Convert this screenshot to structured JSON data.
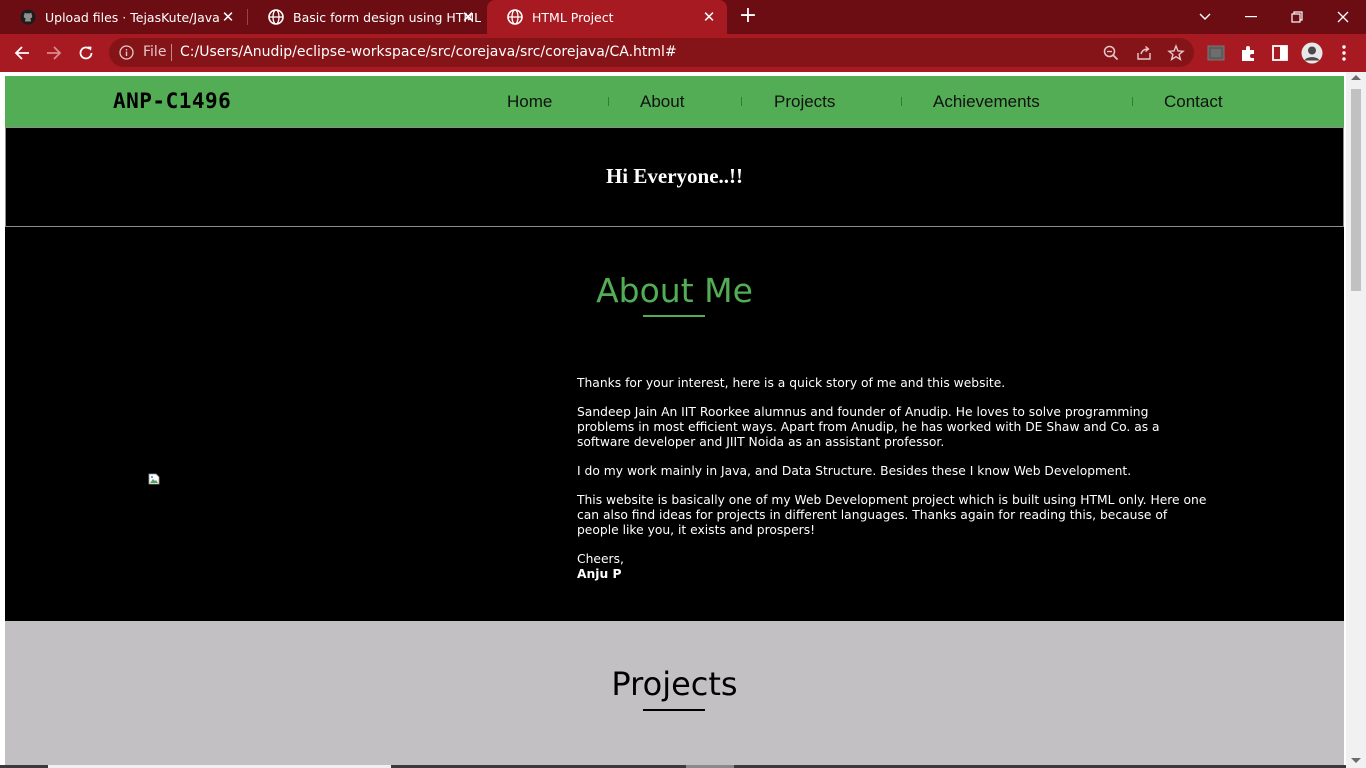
{
  "browser": {
    "tabs": [
      {
        "title": "Upload files · TejasKute/Java",
        "icon": "github-icon",
        "active": false
      },
      {
        "title": "Basic form design using HTML",
        "icon": "globe-icon",
        "active": false
      },
      {
        "title": "HTML Project",
        "icon": "globe-icon",
        "active": true
      }
    ],
    "address": {
      "scheme_label": "File",
      "url": "C:/Users/Anudip/eclipse-workspace/src/corejava/src/corejava/CA.html#"
    },
    "colors": {
      "tabstrip": "#6b0d12",
      "active_tab": "#a71a21",
      "omnibox": "#851419"
    }
  },
  "site": {
    "brand": "ANP-C1496",
    "nav": [
      "Home",
      "About",
      "Projects",
      "Achievements",
      "Contact"
    ],
    "hero_text": "Hi Everyone..!!",
    "about": {
      "title": "About Me",
      "paragraphs": [
        "Thanks for your interest, here is a quick story of me and this website.",
        "Sandeep Jain An IIT Roorkee alumnus and founder of Anudip. He loves to solve programming problems in most efficient ways. Apart from Anudip, he has worked with DE Shaw and Co. as a software developer and JIIT Noida as an assistant professor.",
        "I do my work mainly in Java, and Data Structure. Besides these I know Web Development.",
        "This website is basically one of my Web Development project which is built using HTML only. Here one can also find ideas for projects in different languages. Thanks again for reading this, because of people like you, it exists and prospers!"
      ],
      "signoff": "Cheers,",
      "signature": "Anju P"
    },
    "projects_title": "Projects",
    "colors": {
      "accent": "#52ad54",
      "dark_bg": "#000000",
      "projects_bg": "#c2c0c3"
    }
  }
}
